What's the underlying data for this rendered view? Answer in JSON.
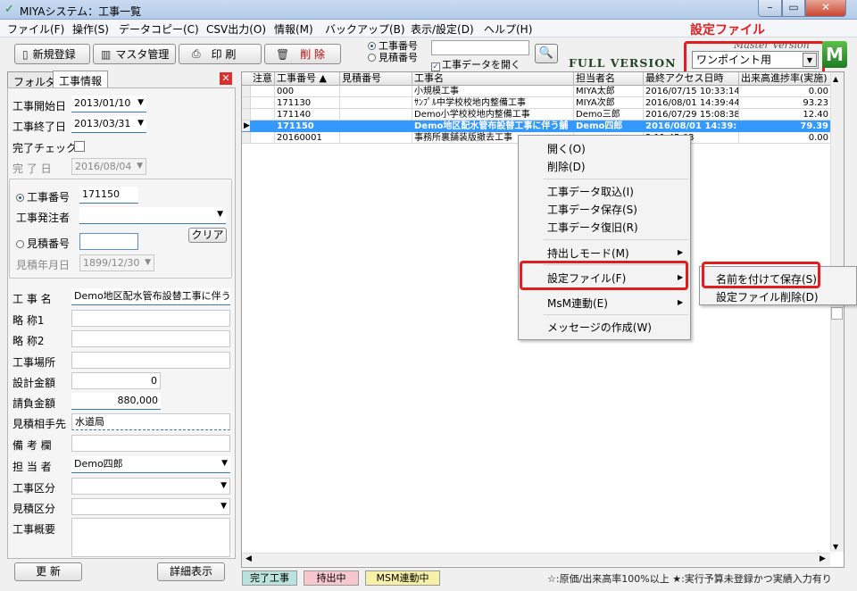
{
  "window": {
    "title": "MIYAシステム：工事一覧",
    "minimize": "–",
    "maximize": "▭",
    "close": "✕"
  },
  "menu": [
    "ファイル(F)",
    "操作(S)",
    "データコピー(C)",
    "CSV出力(O)",
    "情報(M)",
    "バックアップ(B)",
    "表示/設定(D)",
    "ヘルプ(H)"
  ],
  "callout": "設定ファイル",
  "toolbar": {
    "new_label": "新規登録",
    "master_label": "マスタ管理",
    "print_label": "印 刷",
    "delete_label": "削 除",
    "radio_koji": "工事番号",
    "radio_mitsumori": "見積番号",
    "search_value": "",
    "open_data_label": "工事データを開く",
    "full_version": "FULL VERSION",
    "master_version": "Master Version",
    "settings_value": "ワンポイント用",
    "logo": "M"
  },
  "left": {
    "tab_folder": "フォルダ",
    "tab_info": "工事情報",
    "close": "✕",
    "start_label": "工事開始日",
    "start_value": "2013/01/10",
    "end_label": "工事終了日",
    "end_value": "2013/03/31",
    "done_check_label": "完了チェック",
    "done_date_label": "完 了 日",
    "done_date_value": "2016/08/04",
    "koji_no_label": "工事番号",
    "koji_no_value": "171150",
    "client_label": "工事発注者",
    "client_value": "",
    "mitsumori_no_label": "見積番号",
    "mitsumori_no_value": "",
    "clear_label": "クリア",
    "mitsumori_date_label": "見積年月日",
    "mitsumori_date_value": "1899/12/30",
    "name_label": "工 事 名",
    "name_value": "Demo地区配水管布設替工事に伴う舗",
    "short1_label": "略 称1",
    "short1_value": "",
    "short2_label": "略 称2",
    "short2_value": "",
    "place_label": "工事場所",
    "place_value": "",
    "design_label": "設計金額",
    "design_value": "0",
    "contract_label": "請負金額",
    "contract_value": "880,000",
    "est_to_label": "見積相手先",
    "est_to_value": "水道局",
    "note_label": "備 考 欄",
    "note_value": "",
    "person_label": "担 当 者",
    "person_value": "Demo四郎",
    "koji_kubun_label": "工事区分",
    "koji_kubun_value": "",
    "mitsu_kubun_label": "見積区分",
    "mitsu_kubun_value": "",
    "summary_label": "工事概要",
    "summary_value": "",
    "update_label": "更 新",
    "detail_label": "詳細表示"
  },
  "grid": {
    "headers": [
      "注意",
      "工事番号 ▲",
      "見積番号",
      "工事名",
      "担当者名",
      "最終アクセス日時",
      "出来高進捗率(実施)"
    ],
    "rows": [
      {
        "mark": "",
        "koji": "000",
        "mitsu": "",
        "name": "小規模工事",
        "person": "MIYA太郎",
        "access": "2016/07/15 10:33:14",
        "rate": "0.00"
      },
      {
        "mark": "",
        "koji": "171130",
        "mitsu": "",
        "name": "ｻﾝﾌﾟﾙ中学校校地内整備工事",
        "person": "MIYA次郎",
        "access": "2016/08/01 14:39:44",
        "rate": "93.23"
      },
      {
        "mark": "",
        "koji": "171140",
        "mitsu": "",
        "name": "Demo小学校校地内整備工事",
        "person": "Demo三郎",
        "access": "2016/07/29 15:08:38",
        "rate": "12.40"
      },
      {
        "mark": "▶",
        "koji": "171150",
        "mitsu": "",
        "name": "Demo地区配水管布設替工事に伴う舗",
        "person": "Demo四郎",
        "access": "2016/08/01 14:39:",
        "rate": "79.39"
      },
      {
        "mark": "",
        "koji": "20160001",
        "mitsu": "",
        "name": "事務所裏舗装版撤去工事",
        "person": "",
        "access": "2 11:45:03",
        "rate": "0.00"
      }
    ]
  },
  "context_menu": {
    "open": "開く(O)",
    "delete": "削除(D)",
    "import": "工事データ取込(I)",
    "save": "工事データ保存(S)",
    "restore": "工事データ復旧(R)",
    "takeout": "持出しモード(M)",
    "settings": "設定ファイル(F)",
    "msm": "MsM連動(E)",
    "message": "メッセージの作成(W)",
    "sub_save_as": "名前を付けて保存(S)",
    "sub_delete": "設定ファイル削除(D)"
  },
  "status": {
    "completed": "完了工事",
    "takeout": "持出中",
    "msm": "MSM連動中",
    "legend": "☆:原価/出来高率100%以上 ★:実行予算未登録かつ実績入力有り"
  },
  "colors": {
    "accent": "#3399ff",
    "callout": "#e01e1e",
    "completed_bg": "#b9e3dc",
    "takeout_bg": "#f7c7cf",
    "msm_bg": "#f7f1a8"
  }
}
